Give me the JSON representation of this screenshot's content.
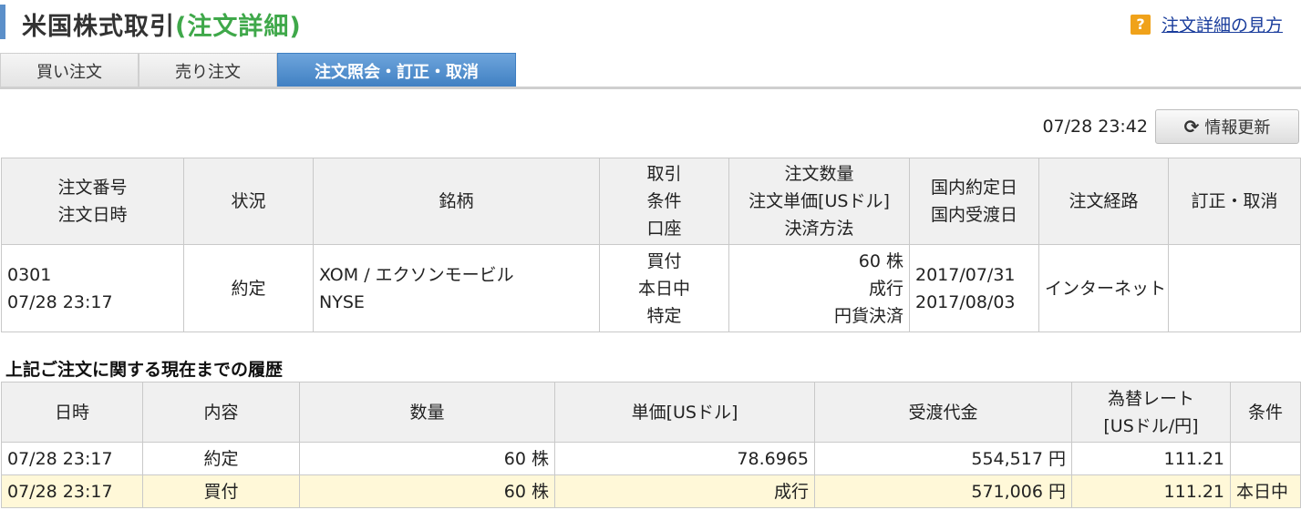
{
  "header": {
    "title": "米国株式取引",
    "subtitle": "(注文詳細)",
    "help_label": "注文詳細の見方"
  },
  "tabs": [
    {
      "label": "買い注文"
    },
    {
      "label": "売り注文"
    },
    {
      "label": "注文照会・訂正・取消"
    }
  ],
  "refresh": {
    "timestamp": "07/28 23:42",
    "button_label": "情報更新"
  },
  "order_table": {
    "headers": {
      "order": [
        "注文番号",
        "注文日時"
      ],
      "status": "状況",
      "symbol": "銘柄",
      "trade": [
        "取引",
        "条件",
        "口座"
      ],
      "quantity": [
        "注文数量",
        "注文単価[USドル]",
        "決済方法"
      ],
      "dates": [
        "国内約定日",
        "国内受渡日"
      ],
      "route": "注文経路",
      "modify": "訂正・取消"
    },
    "row": {
      "order_number": "0301",
      "order_datetime": "07/28 23:17",
      "status": "約定",
      "symbol_name": "XOM / エクソンモービル",
      "market": "NYSE",
      "trade_type": "買付",
      "condition": "本日中",
      "account": "特定",
      "quantity": "60 株",
      "price": "成行",
      "settlement": "円貨決済",
      "exec_date": "2017/07/31",
      "delivery_date": "2017/08/03",
      "route": "インターネット",
      "modify": ""
    }
  },
  "history": {
    "title": "上記ご注文に関する現在までの履歴",
    "headers": {
      "datetime": "日時",
      "content": "内容",
      "quantity": "数量",
      "price": "単価[USドル]",
      "amount": "受渡代金",
      "rate": [
        "為替レート",
        "[USドル/円]"
      ],
      "condition": "条件"
    },
    "rows": [
      {
        "datetime": "07/28 23:17",
        "content": "約定",
        "quantity": "60 株",
        "price": "78.6965",
        "amount": "554,517 円",
        "rate": "111.21",
        "condition": ""
      },
      {
        "datetime": "07/28 23:17",
        "content": "買付",
        "quantity": "60 株",
        "price": "成行",
        "amount": "571,006 円",
        "rate": "111.21",
        "condition": "本日中"
      }
    ]
  }
}
